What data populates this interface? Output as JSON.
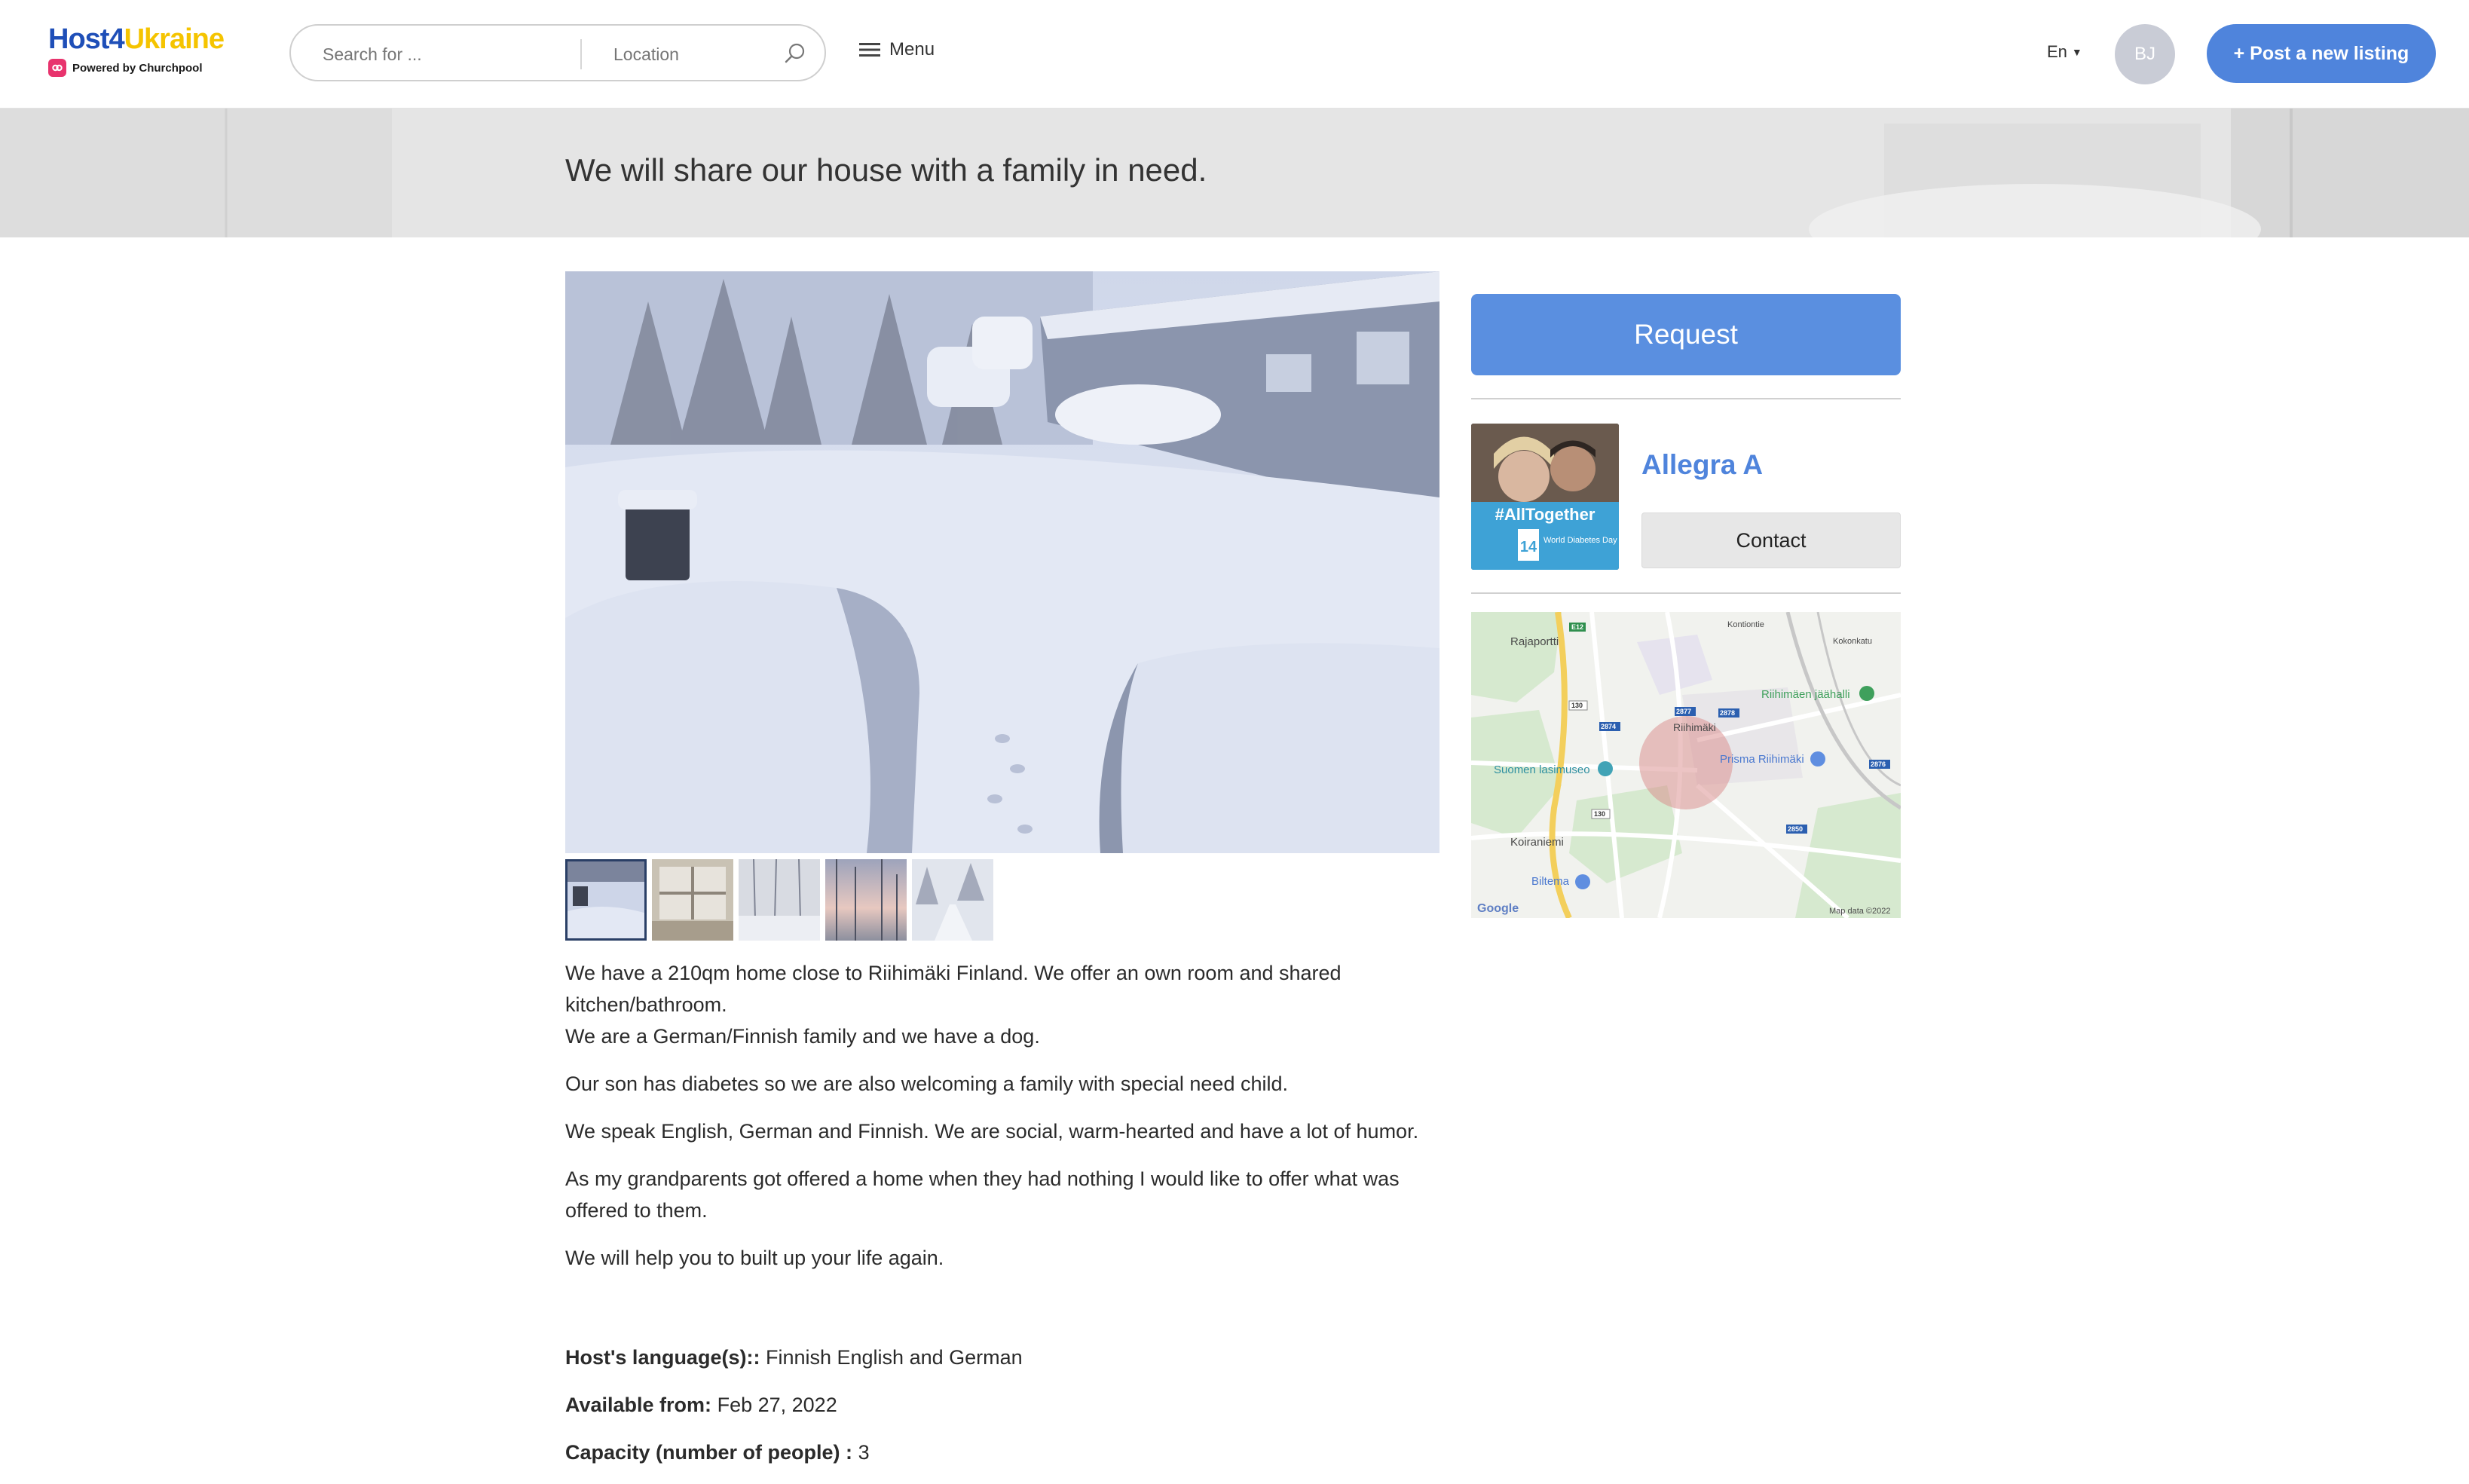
{
  "brand": {
    "name_part1": "Host4",
    "name_part2": "Ukraine",
    "powered_by": "Powered by Churchpool",
    "colors": {
      "blue": "#1f4fb8",
      "yellow": "#f5c400",
      "badge": "#e8336d"
    }
  },
  "header": {
    "search_placeholder": "Search for ...",
    "location_placeholder": "Location",
    "menu_label": "Menu",
    "language": "En",
    "user_initials": "BJ",
    "post_button_label": "+ Post a new listing",
    "accent_color": "#4f84dc"
  },
  "listing": {
    "title": "We will share our house with a family in need.",
    "gallery": {
      "main_image": "snowy driveway with parked cars and house",
      "thumbnails": [
        "snow-driveway",
        "window-interior",
        "snowy-forest",
        "sunset-trees",
        "snowy-road"
      ],
      "active_index": 0
    },
    "description": {
      "line1": "We have a 210qm home close to Riihimäki Finland. We offer an own room and shared kitchen/bathroom.",
      "line2": "We are a German/Finnish family and we have a dog.",
      "p2": "Our son has diabetes so we are also welcoming a family with special need child.",
      "p3": "We speak English, German and Finnish. We are social, warm-hearted and have a lot of humor.",
      "p4": "As my grandparents got offered a home when they had nothing I would like to offer what was offered to them.",
      "p5": "We will help you to built up your life again."
    },
    "facts": [
      {
        "label": "Host's language(s)::",
        "value": "Finnish English and German"
      },
      {
        "label": "Available from:",
        "value": "Feb 27, 2022"
      },
      {
        "label": "Capacity (number of people) :",
        "value": "3"
      }
    ]
  },
  "sidebar": {
    "request_label": "Request",
    "host": {
      "name": "Allegra A",
      "photo_banner": "#AllTogether",
      "photo_badge": "14",
      "photo_caption": "World Diabetes Day"
    },
    "contact_label": "Contact",
    "map": {
      "labels": {
        "rajaportti": "Rajaportti",
        "kontiontie": "Kontiontie",
        "kokonkatu": "Kokonkatu",
        "jaahalli": "Riihimäen jäähalli",
        "riihimaki": "Riihimäki",
        "lasimuseo": "Suomen lasimuseo",
        "prisma": "Prisma Riihimäki",
        "koiraniemi": "Koiraniemi",
        "biltema": "Biltema",
        "google": "Google",
        "mapdata": "Map data ©2022",
        "road_e12": "E12",
        "road_130a": "130",
        "road_130b": "130",
        "road_2874": "2874",
        "road_2877": "2877",
        "road_2878": "2878",
        "road_2876": "2876",
        "road_2850": "2850"
      }
    }
  }
}
